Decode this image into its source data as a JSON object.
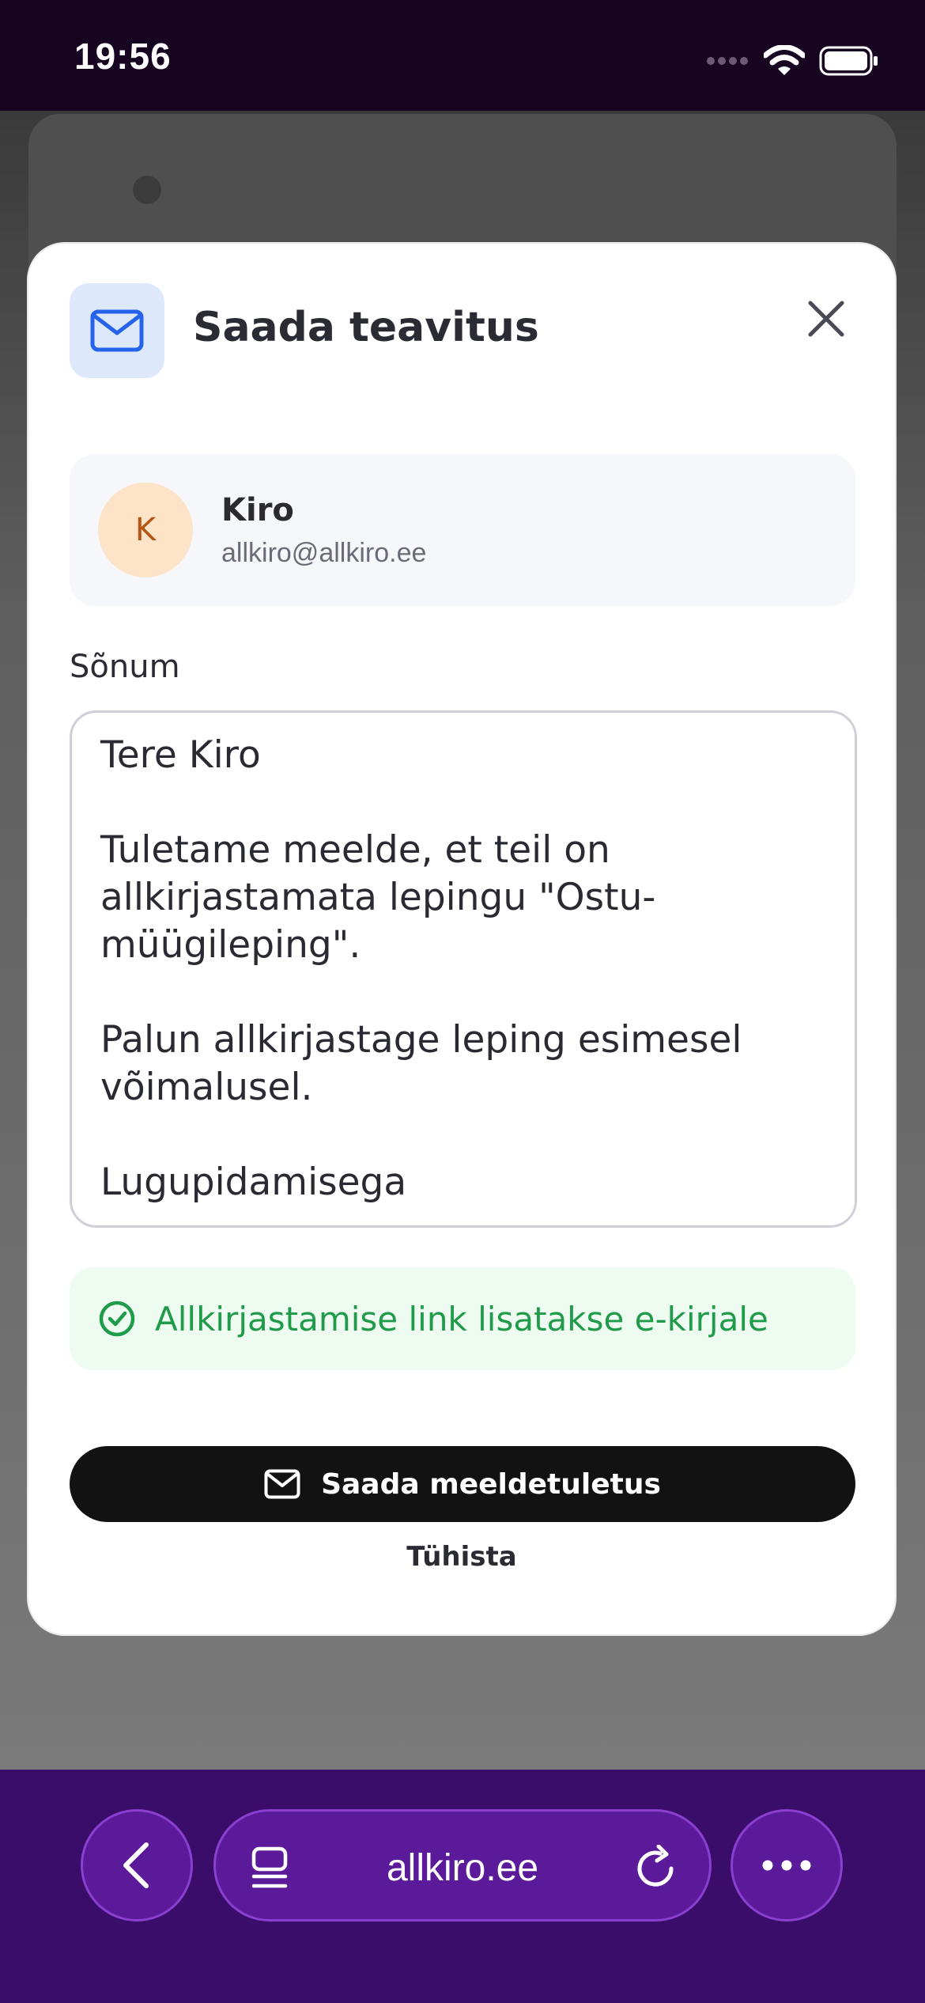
{
  "status_bar": {
    "time": "19:56"
  },
  "modal": {
    "title": "Saada teavitus",
    "recipient": {
      "initial": "K",
      "name": "Kiro",
      "email": "allkiro@allkiro.ee"
    },
    "message_label": "Sõnum",
    "message_text": "Tere Kiro\n\nTuletame meelde, et teil on allkirjastamata lepingu \"Ostu-müügileping\".\n\nPalun allkirjastage leping esimesel võimalusel.\n\nLugupidamisega",
    "notice_text": "Allkirjastamise link lisatakse e-kirjale",
    "send_button_label": "Saada meeldetuletus",
    "cancel_label": "Tühista"
  },
  "browser": {
    "url": "allkiro.ee"
  },
  "colors": {
    "accent_purple": "#5b1a9a",
    "success_green": "#1f9b4a",
    "icon_blue": "#2563eb",
    "avatar_bg": "#fde3c8"
  },
  "icons": {
    "header": "mail-icon",
    "close": "close-icon",
    "notice": "check-circle-icon",
    "send": "mail-icon",
    "back": "chevron-left-icon",
    "tabs": "tabs-icon",
    "reload": "reload-icon",
    "more": "more-icon"
  }
}
